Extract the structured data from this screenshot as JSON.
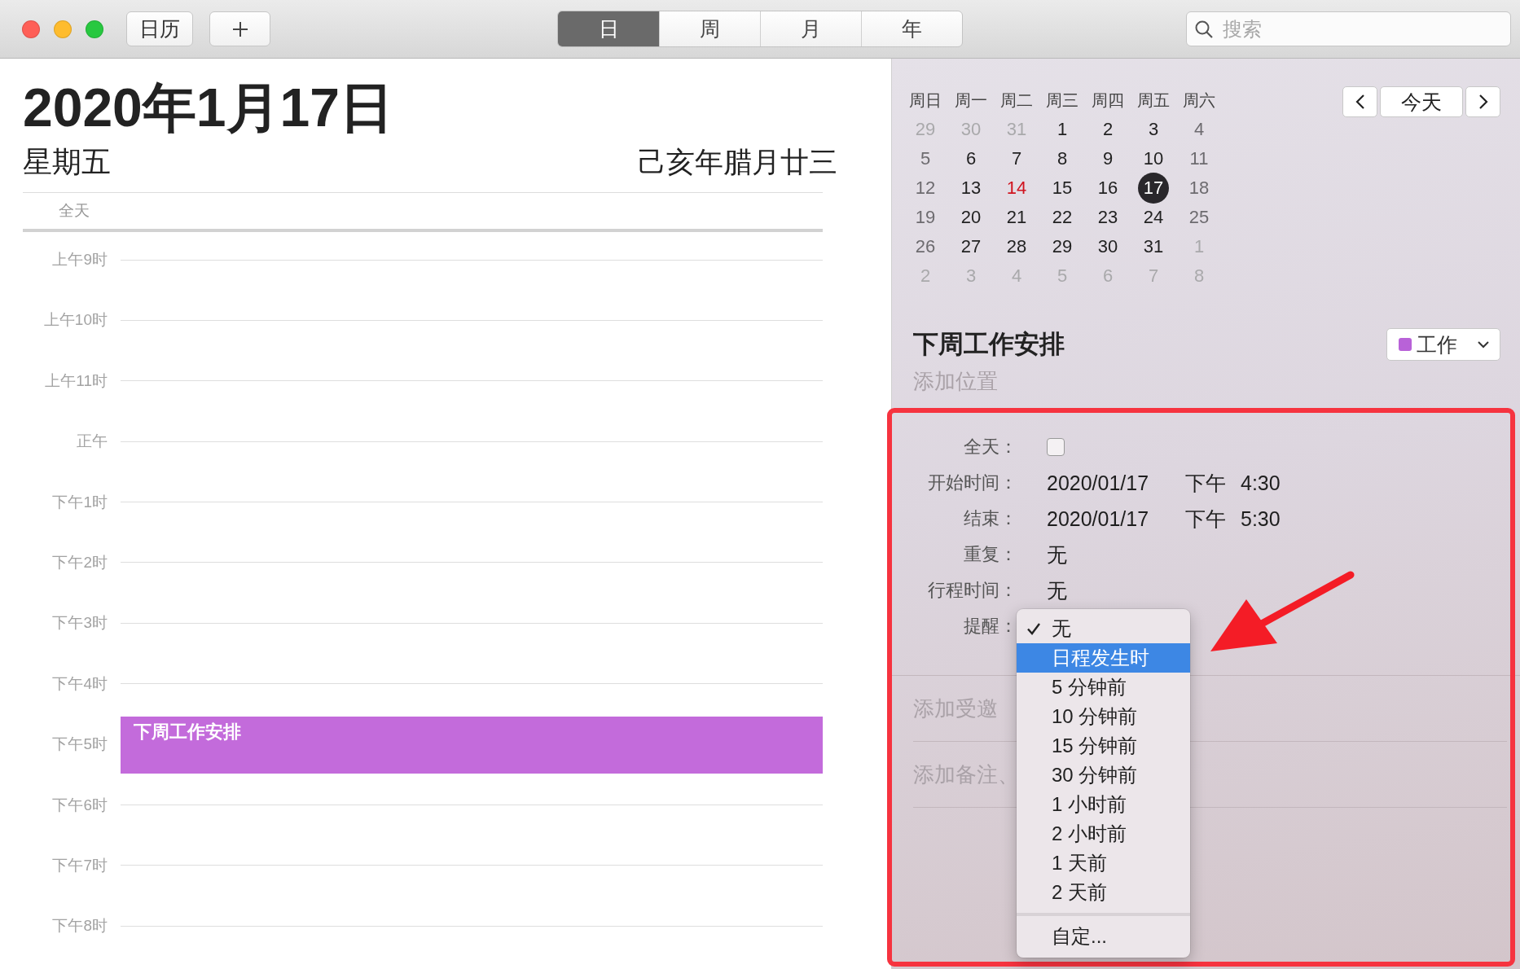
{
  "toolbar": {
    "calendars_button": "日历",
    "view_tabs": [
      {
        "label": "日",
        "selected": true
      },
      {
        "label": "周",
        "selected": false
      },
      {
        "label": "月",
        "selected": false
      },
      {
        "label": "年",
        "selected": false
      }
    ],
    "search": {
      "placeholder": "搜索"
    }
  },
  "day_view": {
    "date_title": "2020年1月17日",
    "weekday": "星期五",
    "lunar_date": "己亥年腊月廿三",
    "all_day_label": "全天",
    "hours": [
      "上午9时",
      "上午10时",
      "上午11时",
      "正午",
      "下午1时",
      "下午2时",
      "下午3时",
      "下午4时",
      "下午5时",
      "下午6时",
      "下午7时",
      "下午8时"
    ],
    "events": [
      {
        "title": "下周工作安排",
        "color": "#c36bdb"
      }
    ]
  },
  "mini_calendar": {
    "weekdays": [
      "周日",
      "周一",
      "周二",
      "周三",
      "周四",
      "周五",
      "周六"
    ],
    "weeks": [
      [
        {
          "day": "29",
          "kind": "outside",
          "selected": false
        },
        {
          "day": "30",
          "kind": "outside",
          "selected": false
        },
        {
          "day": "31",
          "kind": "outside",
          "selected": false
        },
        {
          "day": "1",
          "kind": "weekday",
          "selected": false
        },
        {
          "day": "2",
          "kind": "weekday",
          "selected": false
        },
        {
          "day": "3",
          "kind": "weekday",
          "selected": false
        },
        {
          "day": "4",
          "kind": "weekend",
          "selected": false
        }
      ],
      [
        {
          "day": "5",
          "kind": "weekend",
          "selected": false
        },
        {
          "day": "6",
          "kind": "weekday",
          "selected": false
        },
        {
          "day": "7",
          "kind": "weekday",
          "selected": false
        },
        {
          "day": "8",
          "kind": "weekday",
          "selected": false
        },
        {
          "day": "9",
          "kind": "weekday",
          "selected": false
        },
        {
          "day": "10",
          "kind": "weekday",
          "selected": false
        },
        {
          "day": "11",
          "kind": "weekend",
          "selected": false
        }
      ],
      [
        {
          "day": "12",
          "kind": "weekend",
          "selected": false
        },
        {
          "day": "13",
          "kind": "weekday",
          "selected": false
        },
        {
          "day": "14",
          "kind": "today",
          "selected": false
        },
        {
          "day": "15",
          "kind": "weekday",
          "selected": false
        },
        {
          "day": "16",
          "kind": "weekday",
          "selected": false
        },
        {
          "day": "17",
          "kind": "weekday",
          "selected": true
        },
        {
          "day": "18",
          "kind": "weekend",
          "selected": false
        }
      ],
      [
        {
          "day": "19",
          "kind": "weekend",
          "selected": false
        },
        {
          "day": "20",
          "kind": "weekday",
          "selected": false
        },
        {
          "day": "21",
          "kind": "weekday",
          "selected": false
        },
        {
          "day": "22",
          "kind": "weekday",
          "selected": false
        },
        {
          "day": "23",
          "kind": "weekday",
          "selected": false
        },
        {
          "day": "24",
          "kind": "weekday",
          "selected": false
        },
        {
          "day": "25",
          "kind": "weekend",
          "selected": false
        }
      ],
      [
        {
          "day": "26",
          "kind": "weekend",
          "selected": false
        },
        {
          "day": "27",
          "kind": "weekday",
          "selected": false
        },
        {
          "day": "28",
          "kind": "weekday",
          "selected": false
        },
        {
          "day": "29",
          "kind": "weekday",
          "selected": false
        },
        {
          "day": "30",
          "kind": "weekday",
          "selected": false
        },
        {
          "day": "31",
          "kind": "weekday",
          "selected": false
        },
        {
          "day": "1",
          "kind": "outside",
          "selected": false
        }
      ],
      [
        {
          "day": "2",
          "kind": "outside",
          "selected": false
        },
        {
          "day": "3",
          "kind": "outside",
          "selected": false
        },
        {
          "day": "4",
          "kind": "outside",
          "selected": false
        },
        {
          "day": "5",
          "kind": "outside",
          "selected": false
        },
        {
          "day": "6",
          "kind": "outside",
          "selected": false
        },
        {
          "day": "7",
          "kind": "outside",
          "selected": false
        },
        {
          "day": "8",
          "kind": "outside",
          "selected": false
        }
      ]
    ],
    "today_button": "今天"
  },
  "event_detail": {
    "title": "下周工作安排",
    "location": {
      "placeholder": "添加位置"
    },
    "calendar": {
      "name": "工作",
      "color": "#b862d8"
    },
    "fields": [
      {
        "label": "全天：",
        "kind": "checkbox",
        "checked": false
      },
      {
        "label": "开始时间：",
        "kind": "datetime",
        "date": "2020/01/17",
        "period": "下午",
        "time": "4:30"
      },
      {
        "label": "结束：",
        "kind": "datetime",
        "date": "2020/01/17",
        "period": "下午",
        "time": "5:30"
      },
      {
        "label": "重复：",
        "kind": "text",
        "value": "无"
      },
      {
        "label": "行程时间：",
        "kind": "text",
        "value": "无"
      },
      {
        "label": "提醒：",
        "kind": "menu"
      }
    ],
    "invitees": {
      "placeholder": "添加受邀"
    },
    "notes": {
      "placeholder": "添加备注、"
    }
  },
  "reminder_menu": {
    "items": [
      {
        "label": "无",
        "kind": "option",
        "checked": true,
        "selected": false
      },
      {
        "label": "日程发生时",
        "kind": "option",
        "checked": false,
        "selected": true
      },
      {
        "label": "5 分钟前",
        "kind": "option",
        "checked": false,
        "selected": false
      },
      {
        "label": "10 分钟前",
        "kind": "option",
        "checked": false,
        "selected": false
      },
      {
        "label": "15 分钟前",
        "kind": "option",
        "checked": false,
        "selected": false
      },
      {
        "label": "30 分钟前",
        "kind": "option",
        "checked": false,
        "selected": false
      },
      {
        "label": "1 小时前",
        "kind": "option",
        "checked": false,
        "selected": false
      },
      {
        "label": "2 小时前",
        "kind": "option",
        "checked": false,
        "selected": false
      },
      {
        "label": "1 天前",
        "kind": "option",
        "checked": false,
        "selected": false
      },
      {
        "label": "2 天前",
        "kind": "option",
        "checked": false,
        "selected": false
      },
      {
        "label": "自定...",
        "kind": "custom",
        "checked": false,
        "selected": false
      }
    ]
  }
}
